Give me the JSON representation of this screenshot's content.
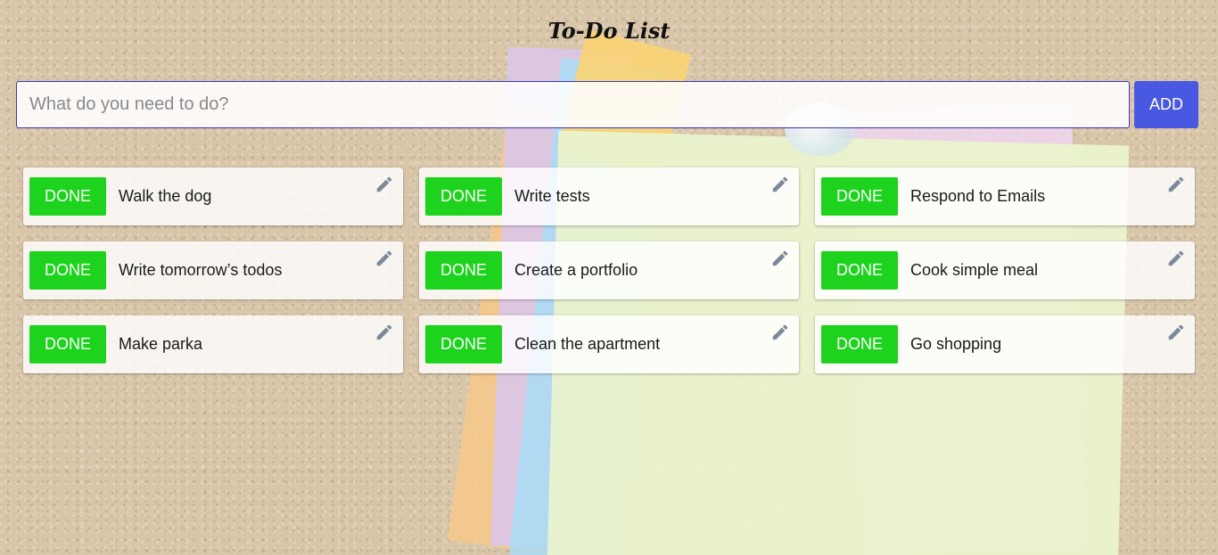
{
  "app": {
    "title": "To-Do List"
  },
  "input": {
    "placeholder": "What do you need to do?",
    "value": ""
  },
  "add_button": {
    "label": "ADD"
  },
  "colors": {
    "add": "#4858e0",
    "done": "#1ed31e",
    "input_border": "#3b35b8"
  },
  "todos": [
    {
      "done_label": "DONE",
      "text": "Walk the dog",
      "icon": "pencil-icon"
    },
    {
      "done_label": "DONE",
      "text": "Write tests",
      "icon": "pencil-icon"
    },
    {
      "done_label": "DONE",
      "text": "Respond to Emails",
      "icon": "pencil-icon"
    },
    {
      "done_label": "DONE",
      "text": "Write tomorrow’s todos",
      "icon": "pencil-icon"
    },
    {
      "done_label": "DONE",
      "text": "Create a portfolio",
      "icon": "pencil-icon"
    },
    {
      "done_label": "DONE",
      "text": "Cook simple meal",
      "icon": "pencil-icon"
    },
    {
      "done_label": "DONE",
      "text": "Make parka",
      "icon": "pencil-icon"
    },
    {
      "done_label": "DONE",
      "text": "Clean the apartment",
      "icon": "pencil-icon"
    },
    {
      "done_label": "DONE",
      "text": "Go shopping",
      "icon": "pencil-icon"
    }
  ]
}
